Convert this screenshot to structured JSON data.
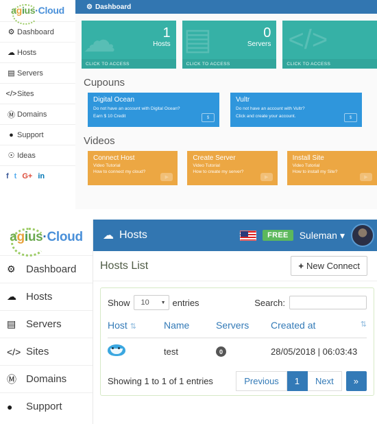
{
  "brand": {
    "name_parts": [
      "a",
      "g",
      "i",
      "u",
      "s",
      "·",
      "Cloud"
    ],
    "full": "agius·Cloud"
  },
  "top_section": {
    "header": {
      "title": "Dashboard",
      "icon": "gears-icon"
    },
    "sidebar": {
      "items": [
        {
          "label": "Dashboard",
          "icon": "gears-icon"
        },
        {
          "label": "Hosts",
          "icon": "cloud-icon"
        },
        {
          "label": "Servers",
          "icon": "server-icon"
        },
        {
          "label": "Sites",
          "icon": "code-icon"
        },
        {
          "label": "Domains",
          "icon": "binoculars-icon"
        },
        {
          "label": "Support",
          "icon": "comment-icon"
        },
        {
          "label": "Ideas",
          "icon": "lightbulb-icon"
        }
      ],
      "social": [
        {
          "label": "f",
          "name": "facebook-icon",
          "color": "#3b5998"
        },
        {
          "label": "t",
          "name": "twitter-icon",
          "color": "#55acee"
        },
        {
          "label": "G+",
          "name": "google-plus-icon",
          "color": "#dd4b39"
        },
        {
          "label": "in",
          "name": "linkedin-icon",
          "color": "#0077b5"
        }
      ]
    },
    "tiles": [
      {
        "value": "1",
        "label": "Hosts",
        "cta": "CLICK TO ACCESS",
        "icon": "cloud-icon"
      },
      {
        "value": "0",
        "label": "Servers",
        "cta": "CLICK TO ACCESS",
        "icon": "server-icon"
      },
      {
        "value": "",
        "label": "",
        "cta": "CLICK TO ACCESS",
        "icon": "code-icon"
      }
    ],
    "coupons_heading": "Cupouns",
    "coupons": [
      {
        "title": "Digital Ocean",
        "line1": "Do not have an account with Digital Ocean?",
        "line2": "Earn $ 10 Credit",
        "icon": "money-icon"
      },
      {
        "title": "Vultr",
        "line1": "Do not have an account with Vultr?",
        "line2": "Click and create your account.",
        "icon": "money-icon"
      }
    ],
    "videos_heading": "Videos",
    "videos": [
      {
        "title": "Connect Host",
        "line1": "Video Tutorial",
        "line2": "How to connect my cloud?",
        "icon": "play-icon"
      },
      {
        "title": "Create Server",
        "line1": "Video Tutorial",
        "line2": "How to create my server?",
        "icon": "play-icon"
      },
      {
        "title": "Install Site",
        "line1": "Video Tutorial",
        "line2": "How to install my Site?",
        "icon": "play-icon"
      }
    ]
  },
  "bottom_section": {
    "sidebar": {
      "items": [
        {
          "label": "Dashboard",
          "icon": "gears-icon"
        },
        {
          "label": "Hosts",
          "icon": "cloud-icon"
        },
        {
          "label": "Servers",
          "icon": "server-icon"
        },
        {
          "label": "Sites",
          "icon": "code-icon"
        },
        {
          "label": "Domains",
          "icon": "binoculars-icon"
        },
        {
          "label": "Support",
          "icon": "comment-icon"
        }
      ]
    },
    "header": {
      "title": "Hosts",
      "icon": "cloud-icon",
      "flag": "us-flag-icon",
      "plan_badge": "FREE",
      "user": "Suleman",
      "caret": "▾",
      "avatar": "user-avatar"
    },
    "panel": {
      "title": "Hosts List",
      "new_button": "New Connect",
      "new_button_icon": "plus-icon"
    },
    "table_controls": {
      "show_label": "Show",
      "entries_label": "entries",
      "page_size": "10",
      "search_label": "Search:",
      "search_value": "",
      "search_placeholder": ""
    },
    "table": {
      "columns": [
        "Host",
        "Name",
        "Servers",
        "Created at"
      ],
      "rows": [
        {
          "host_icon": "dolphin-icon",
          "name": "test",
          "servers": "0",
          "created_at": "28/05/2018 | 06:03:43"
        }
      ]
    },
    "footer": {
      "info": "Showing 1 to 1 of 1 entries",
      "previous": "Previous",
      "page": "1",
      "next": "Next",
      "last": "»"
    }
  },
  "colors": {
    "primary_blue": "#3276b1",
    "teal_tile": "#36b1a6",
    "coupon_blue": "#2f96dc",
    "video_orange": "#eca743",
    "free_green": "#5cb85c",
    "link_blue": "#337ab7"
  }
}
